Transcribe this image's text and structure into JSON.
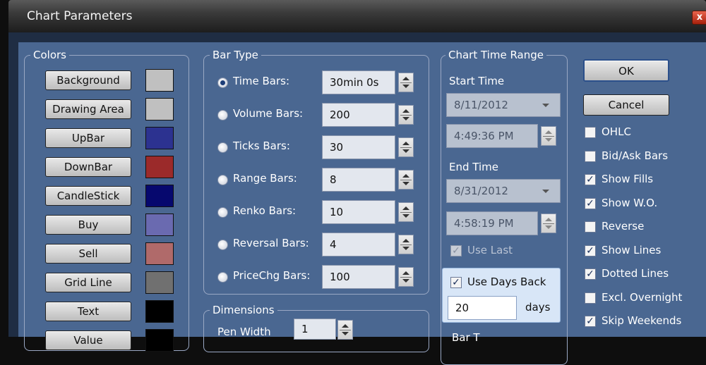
{
  "window": {
    "title": "Chart Parameters",
    "close_glyph": "x"
  },
  "colors_group": {
    "legend": "Colors",
    "items": [
      {
        "label": "Background",
        "color": "#c0c0c0"
      },
      {
        "label": "Drawing Area",
        "color": "#c0c0c0"
      },
      {
        "label": "UpBar",
        "color": "#2c3290"
      },
      {
        "label": "DownBar",
        "color": "#9b2a2a"
      },
      {
        "label": "CandleStick",
        "color": "#06086e"
      },
      {
        "label": "Buy",
        "color": "#6a6ab0"
      },
      {
        "label": "Sell",
        "color": "#b06a6a"
      },
      {
        "label": "Grid Line",
        "color": "#707070"
      },
      {
        "label": "Text",
        "color": "#000000"
      },
      {
        "label": "Value",
        "color": "#000000"
      }
    ]
  },
  "bar_type_group": {
    "legend": "Bar Type",
    "options": [
      {
        "label": "Time Bars:",
        "value": "30min 0s",
        "selected": true
      },
      {
        "label": "Volume Bars:",
        "value": "200",
        "selected": false
      },
      {
        "label": "Ticks Bars:",
        "value": "30",
        "selected": false
      },
      {
        "label": "Range Bars:",
        "value": "8",
        "selected": false
      },
      {
        "label": "Renko Bars:",
        "value": "10",
        "selected": false
      },
      {
        "label": "Reversal Bars:",
        "value": "4",
        "selected": false
      },
      {
        "label": "PriceChg Bars:",
        "value": "100",
        "selected": false
      }
    ]
  },
  "dimensions_group": {
    "legend": "Dimensions",
    "pen_width_label": "Pen Width",
    "pen_width_value": "1"
  },
  "time_range_group": {
    "legend": "Chart Time Range",
    "start_label": "Start Time",
    "start_date": "8/11/2012",
    "start_time": "4:49:36 PM",
    "end_label": "End Time",
    "end_date": "8/31/2012",
    "end_time": "4:58:19 PM",
    "use_last_label": "Use Last",
    "use_days_back_label": "Use Days Back",
    "days_value": "20",
    "days_unit": "days",
    "next_legend": "Bar T"
  },
  "buttons": {
    "ok": "OK",
    "cancel": "Cancel"
  },
  "options": [
    {
      "label": "OHLC",
      "checked": false
    },
    {
      "label": "Bid/Ask Bars",
      "checked": false
    },
    {
      "label": "Show Fills",
      "checked": true
    },
    {
      "label": "Show W.O.",
      "checked": true
    },
    {
      "label": "Reverse",
      "checked": false
    },
    {
      "label": "Show Lines",
      "checked": true
    },
    {
      "label": "Dotted Lines",
      "checked": true
    },
    {
      "label": "Excl. Overnight",
      "checked": false
    },
    {
      "label": "Skip Weekends",
      "checked": true
    }
  ],
  "check_glyph": "✓"
}
